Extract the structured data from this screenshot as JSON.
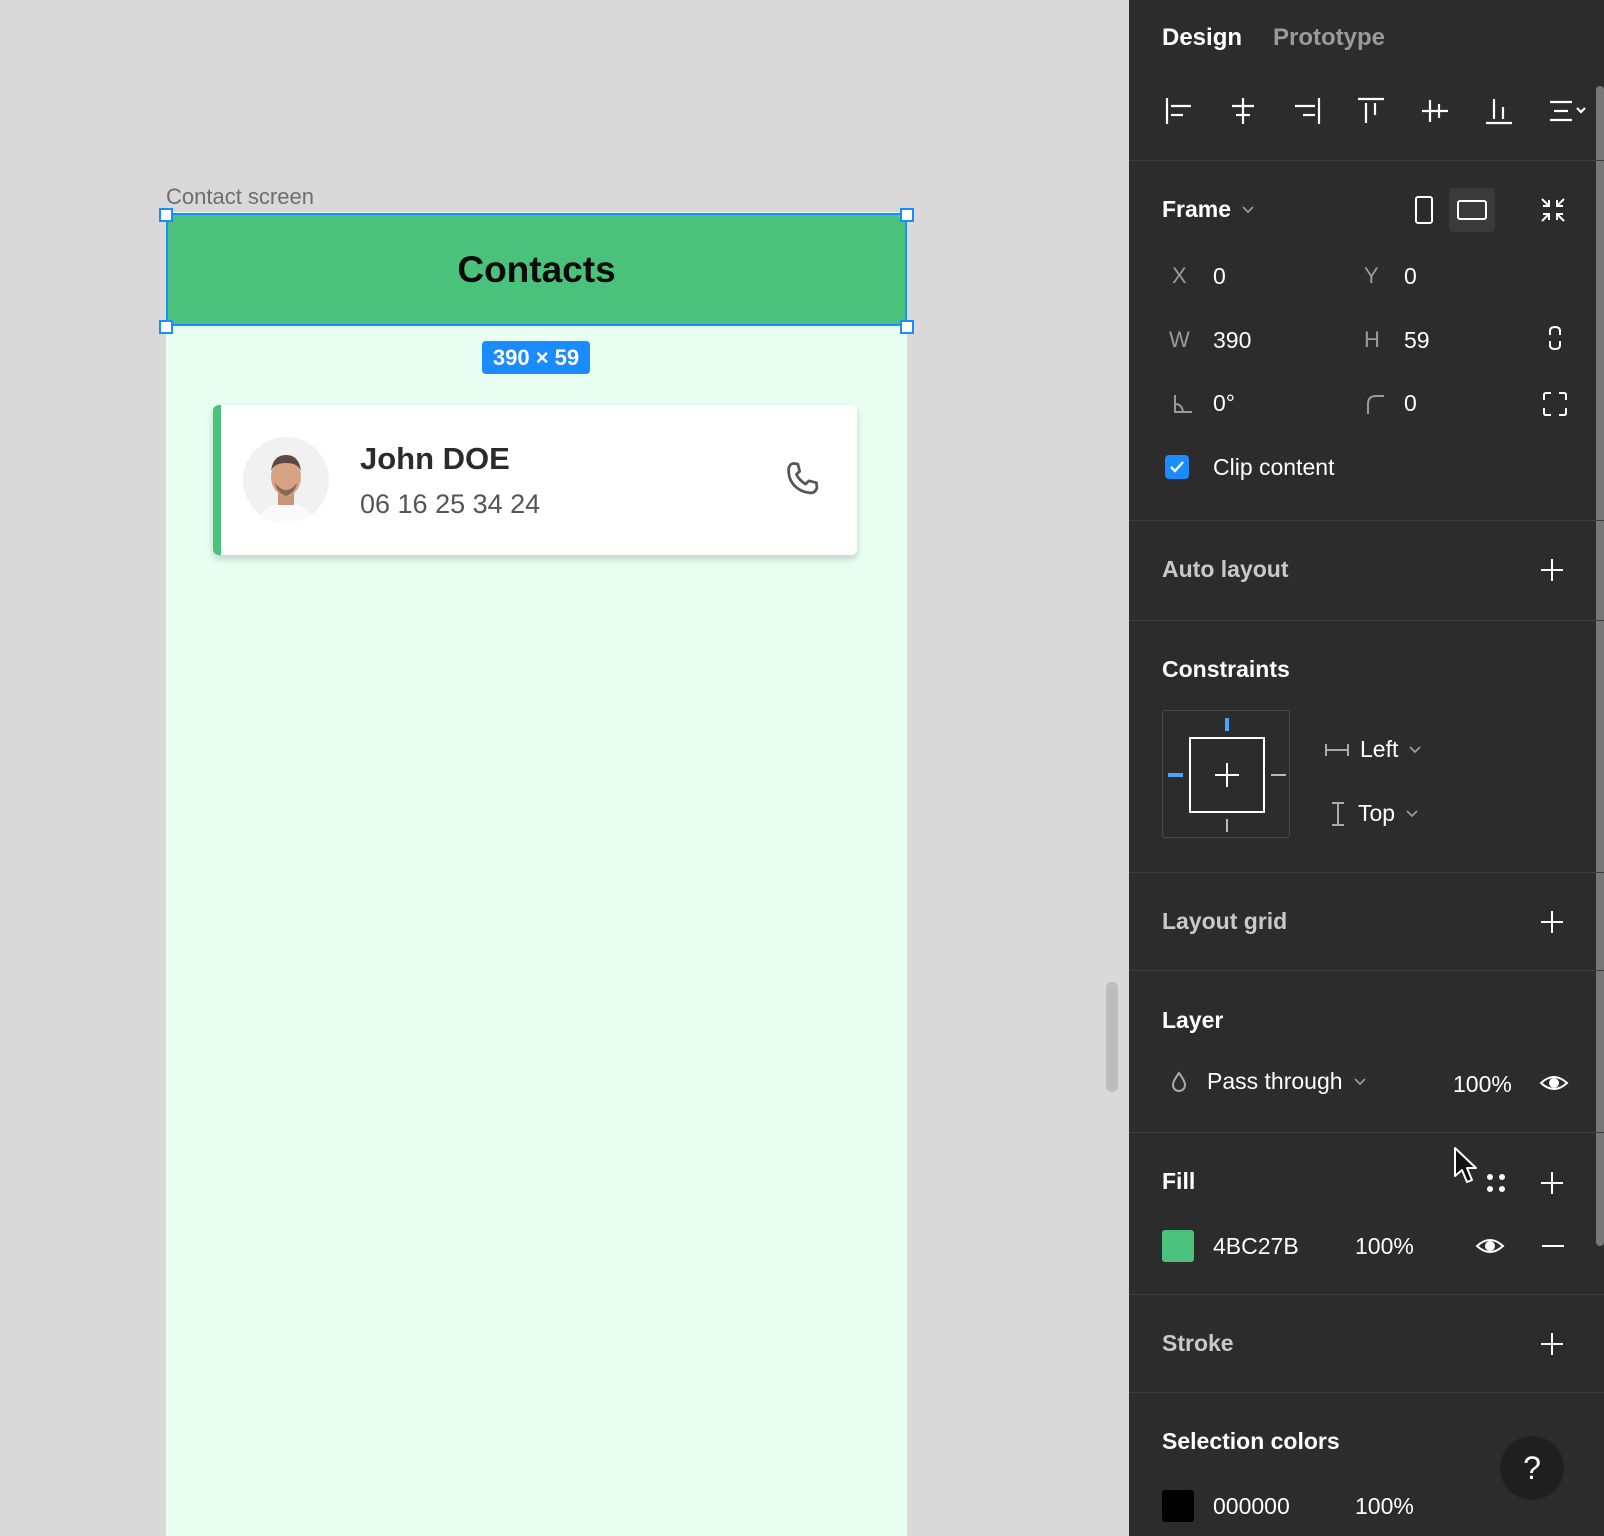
{
  "canvas": {
    "frame_label": "Contact screen",
    "header_title": "Contacts",
    "header_color": "#4BC27B",
    "size_badge": "390 × 59",
    "contact": {
      "name": "John DOE",
      "phone": "06 16 25 34 24"
    }
  },
  "panel": {
    "tabs": [
      "Design",
      "Prototype"
    ],
    "active_tab": "Design",
    "align_icons": [
      "align-left-icon",
      "align-horizontal-center-icon",
      "align-right-icon",
      "align-top-icon",
      "align-vertical-center-icon",
      "align-bottom-icon",
      "distribute-icon"
    ],
    "frame": {
      "title": "Frame",
      "x_label": "X",
      "x": "0",
      "y_label": "Y",
      "y": "0",
      "w_label": "W",
      "w": "390",
      "h_label": "H",
      "h": "59",
      "rotation": "0°",
      "radius": "0",
      "clip_content_label": "Clip content",
      "clip_content": true
    },
    "auto_layout": {
      "title": "Auto layout"
    },
    "constraints": {
      "title": "Constraints",
      "horizontal": "Left",
      "vertical": "Top"
    },
    "layout_grid": {
      "title": "Layout grid"
    },
    "layer": {
      "title": "Layer",
      "blend_mode": "Pass through",
      "opacity": "100%"
    },
    "fill": {
      "title": "Fill",
      "hex": "4BC27B",
      "opacity": "100%",
      "color": "#4BC27B"
    },
    "stroke": {
      "title": "Stroke"
    },
    "selection_colors": {
      "title": "Selection colors",
      "hex": "000000",
      "opacity": "100%",
      "color": "#000000"
    },
    "help_label": "?"
  }
}
